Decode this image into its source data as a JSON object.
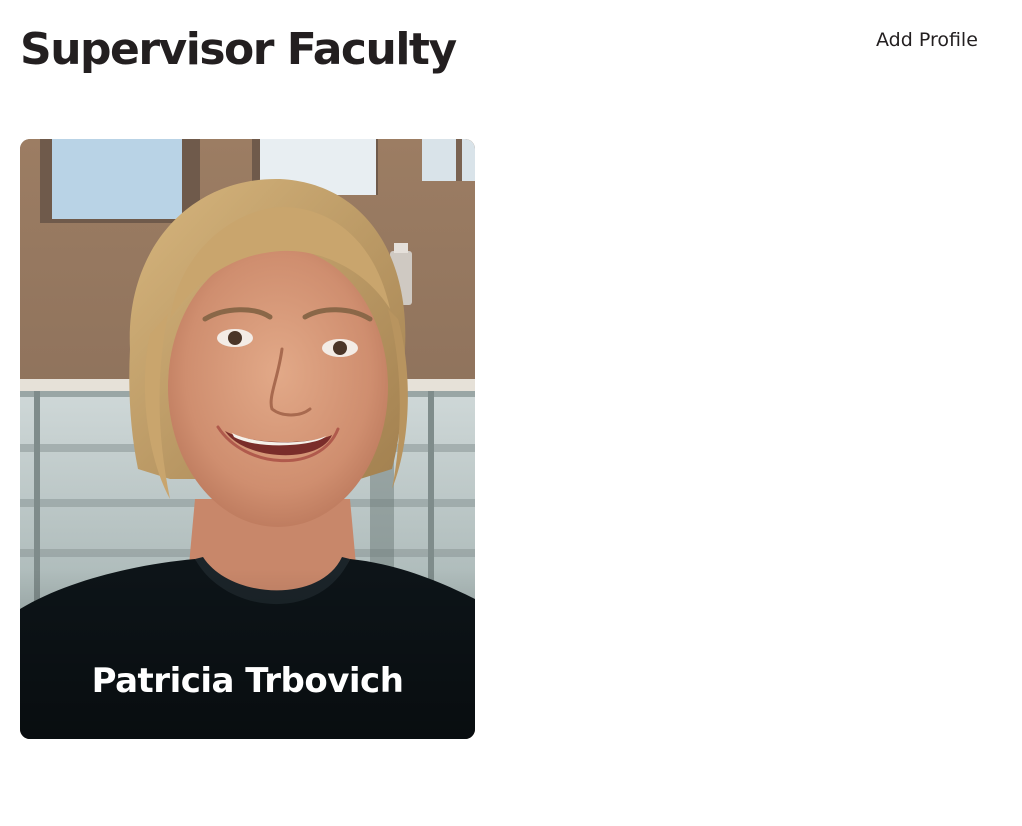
{
  "header": {
    "title": "Supervisor Faculty",
    "add_profile_label": "Add Profile"
  },
  "profiles": [
    {
      "name": "Patricia Trbovich",
      "photo": "portrait-photo"
    }
  ],
  "colors": {
    "text": "#231f20",
    "card_name_text": "#ffffff",
    "background": "#ffffff"
  }
}
